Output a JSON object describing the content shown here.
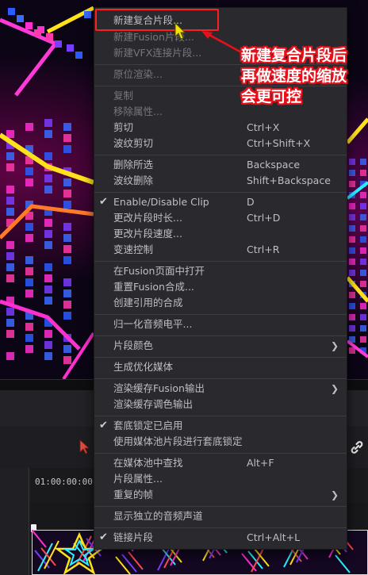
{
  "timeline": {
    "timecode": "01:00:00:00"
  },
  "context_menu": {
    "items": [
      {
        "label": "新建复合片段...",
        "shortcut": "",
        "enabled": true,
        "checked": false,
        "submenu": false,
        "highlighted": true
      },
      {
        "label": "新建Fusion片段...",
        "shortcut": "",
        "enabled": false,
        "checked": false,
        "submenu": false
      },
      {
        "label": "新建VFX连接片段...",
        "shortcut": "",
        "enabled": false,
        "checked": false,
        "submenu": false
      },
      {
        "label": "原位渲染...",
        "shortcut": "",
        "enabled": false,
        "checked": false,
        "submenu": false
      },
      {
        "label": "复制",
        "shortcut": "",
        "enabled": false,
        "checked": false,
        "submenu": false
      },
      {
        "label": "移除属性...",
        "shortcut": "",
        "enabled": false,
        "checked": false,
        "submenu": false
      },
      {
        "label": "剪切",
        "shortcut": "Ctrl+X",
        "enabled": true,
        "checked": false,
        "submenu": false
      },
      {
        "label": "波纹剪切",
        "shortcut": "Ctrl+Shift+X",
        "enabled": true,
        "checked": false,
        "submenu": false
      },
      {
        "label": "删除所选",
        "shortcut": "Backspace",
        "enabled": true,
        "checked": false,
        "submenu": false
      },
      {
        "label": "波纹删除",
        "shortcut": "Shift+Backspace",
        "enabled": true,
        "checked": false,
        "submenu": false
      },
      {
        "label": "Enable/Disable Clip",
        "shortcut": "D",
        "enabled": true,
        "checked": true,
        "submenu": false
      },
      {
        "label": "更改片段时长...",
        "shortcut": "Ctrl+D",
        "enabled": true,
        "checked": false,
        "submenu": false
      },
      {
        "label": "更改片段速度...",
        "shortcut": "",
        "enabled": true,
        "checked": false,
        "submenu": false
      },
      {
        "label": "变速控制",
        "shortcut": "Ctrl+R",
        "enabled": true,
        "checked": false,
        "submenu": false
      },
      {
        "label": "在Fusion页面中打开",
        "shortcut": "",
        "enabled": true,
        "checked": false,
        "submenu": false
      },
      {
        "label": "重置Fusion合成...",
        "shortcut": "",
        "enabled": true,
        "checked": false,
        "submenu": false
      },
      {
        "label": "创建引用的合成",
        "shortcut": "",
        "enabled": true,
        "checked": false,
        "submenu": false
      },
      {
        "label": "归一化音频电平...",
        "shortcut": "",
        "enabled": true,
        "checked": false,
        "submenu": false
      },
      {
        "label": "片段颜色",
        "shortcut": "",
        "enabled": true,
        "checked": false,
        "submenu": true
      },
      {
        "label": "生成优化媒体",
        "shortcut": "",
        "enabled": true,
        "checked": false,
        "submenu": false
      },
      {
        "label": "渲染缓存Fusion输出",
        "shortcut": "",
        "enabled": true,
        "checked": false,
        "submenu": true
      },
      {
        "label": "渲染缓存调色输出",
        "shortcut": "",
        "enabled": true,
        "checked": false,
        "submenu": false
      },
      {
        "label": "套底锁定已启用",
        "shortcut": "",
        "enabled": true,
        "checked": true,
        "submenu": false
      },
      {
        "label": "使用媒体池片段进行套底锁定",
        "shortcut": "",
        "enabled": true,
        "checked": false,
        "submenu": false
      },
      {
        "label": "在媒体池中查找",
        "shortcut": "Alt+F",
        "enabled": true,
        "checked": false,
        "submenu": false
      },
      {
        "label": "片段属性...",
        "shortcut": "",
        "enabled": true,
        "checked": false,
        "submenu": false
      },
      {
        "label": "重复的帧",
        "shortcut": "",
        "enabled": true,
        "checked": false,
        "submenu": true
      },
      {
        "label": "显示独立的音频声道",
        "shortcut": "",
        "enabled": true,
        "checked": false,
        "submenu": false
      },
      {
        "label": "链接片段",
        "shortcut": "Ctrl+Alt+L",
        "enabled": true,
        "checked": true,
        "submenu": false
      }
    ]
  },
  "annotation": {
    "lines": [
      "新建复合片段后",
      "再做速度的缩放",
      "会更可控"
    ],
    "color": "#e8101a"
  },
  "icons": {
    "check": "checkmark-icon",
    "submenu": "chevron-right-icon",
    "link": "link-icon",
    "pointer": "mouse-pointer-icon"
  }
}
